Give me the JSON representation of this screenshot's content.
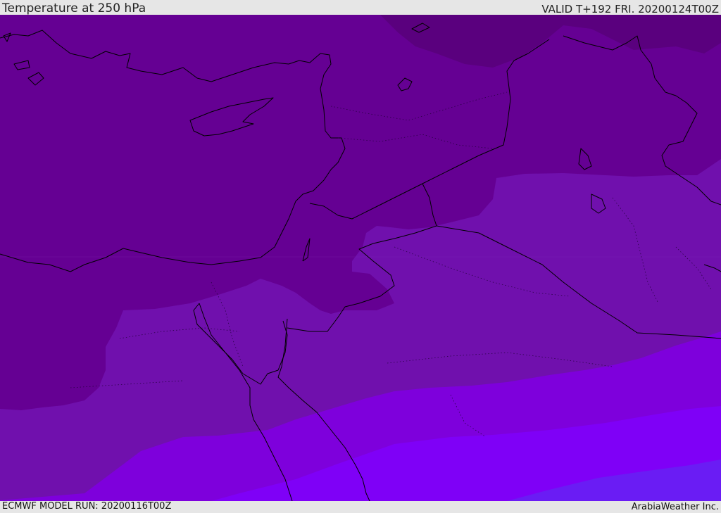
{
  "header": {
    "title": "Temperature at 250 hPa",
    "valid": "VALID T+192 FRI. 20200124T00Z"
  },
  "footer": {
    "model_run": "ECMWF MODEL RUN: 20200116T00Z",
    "credit": "ArabiaWeather Inc."
  },
  "colors": {
    "band_darkest": "#5a007e",
    "band_dark": "#650093",
    "band_mid": "#7010ad",
    "band_bright": "#7e00dc",
    "band_brighter": "#7f00f7",
    "band_blue": "#6a1cf4",
    "border": "#000000",
    "background": "#e6e6e6"
  }
}
